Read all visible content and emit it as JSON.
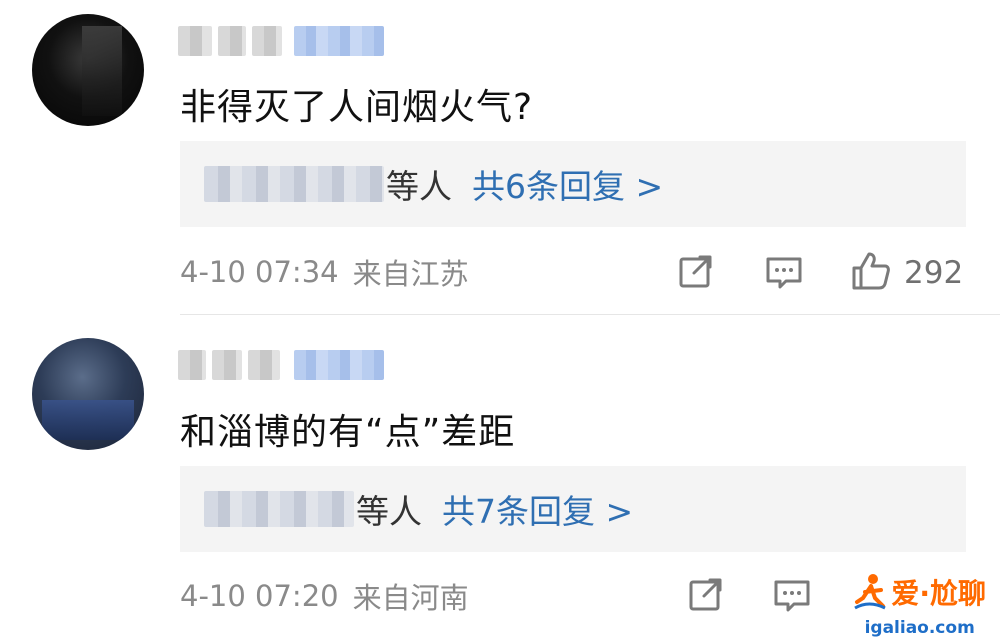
{
  "comments": [
    {
      "text": "非得灭了人间烟火气?",
      "reply_suffix": "等人",
      "reply_link": "共6条回复 >",
      "time": "4-10 07:34",
      "location": "来自江苏",
      "likes": "292"
    },
    {
      "text": "和淄博的有“点”差距",
      "reply_suffix": "等人",
      "reply_link": "共7条回复 >",
      "time": "4-10 07:20",
      "location": "来自河南",
      "likes": ""
    }
  ],
  "watermark": {
    "title": "爱·尬聊",
    "url": "igaliao.com"
  },
  "icons": [
    "share-icon",
    "comment-icon",
    "like-icon"
  ],
  "colors": {
    "link": "#2f6fb2",
    "meta": "#8a8a8a",
    "reply_bg": "#f4f4f4",
    "watermark_orange": "#ff6a00",
    "watermark_blue": "#1e6ec8"
  }
}
